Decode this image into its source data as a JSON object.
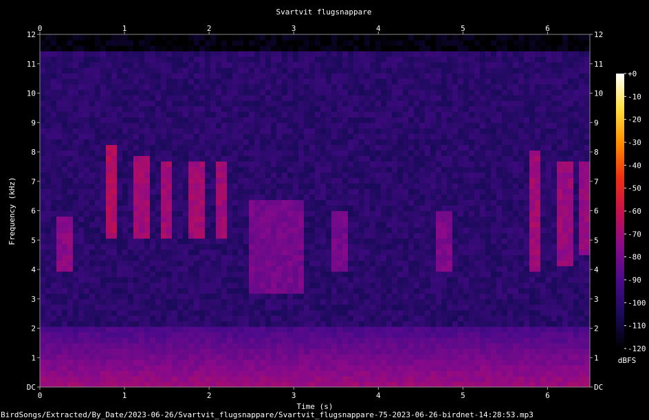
{
  "chart_data": {
    "type": "heatmap",
    "title": "Svartvit flugsnappare",
    "xlabel": "Time (s)",
    "ylabel": "Frequency (kHz)",
    "xlim": [
      0,
      6.5
    ],
    "ylim": [
      0,
      12
    ],
    "x_ticks": [
      "0",
      "1",
      "2",
      "3",
      "4",
      "5",
      "6"
    ],
    "y_ticks": [
      "DC",
      "1",
      "2",
      "3",
      "4",
      "5",
      "6",
      "7",
      "8",
      "9",
      "10",
      "11",
      "12"
    ],
    "colorbar": {
      "label": "dBFS",
      "ticks": [
        "+0",
        "-10",
        "-20",
        "-30",
        "-40",
        "-50",
        "-60",
        "-70",
        "-80",
        "-90",
        "-100",
        "-110",
        "-120"
      ],
      "range": [
        -120,
        0
      ],
      "colors": [
        "#000000",
        "#1a0a5a",
        "#4a0a8a",
        "#8a0a8a",
        "#c8104a",
        "#f03010",
        "#ff9000",
        "#ffe040",
        "#ffffff"
      ]
    },
    "background_level_db": -100,
    "calls": [
      {
        "t": 0.85,
        "f_low": 5.0,
        "f_high": 8.3,
        "level_db": -65
      },
      {
        "t": 1.2,
        "f_low": 5.1,
        "f_high": 7.9,
        "level_db": -70
      },
      {
        "t": 1.5,
        "f_low": 5.1,
        "f_high": 7.7,
        "level_db": -70
      },
      {
        "t": 1.85,
        "f_low": 5.1,
        "f_high": 7.7,
        "level_db": -70
      },
      {
        "t": 2.15,
        "f_low": 5.0,
        "f_high": 7.6,
        "level_db": -70
      },
      {
        "t": 0.3,
        "f_low": 4.0,
        "f_high": 5.9,
        "level_db": -75
      },
      {
        "t": 5.85,
        "f_low": 4.0,
        "f_high": 8.0,
        "level_db": -70
      },
      {
        "t": 6.2,
        "f_low": 4.2,
        "f_high": 7.7,
        "level_db": -72
      },
      {
        "t": 6.45,
        "f_low": 4.5,
        "f_high": 7.6,
        "level_db": -72
      },
      {
        "t": 4.8,
        "f_low": 4.0,
        "f_high": 6.0,
        "level_db": -78
      },
      {
        "t": 3.55,
        "f_low": 4.0,
        "f_high": 6.0,
        "level_db": -80
      }
    ],
    "noise_block": {
      "t_start": 2.45,
      "t_end": 3.1,
      "f_low": 3.2,
      "f_high": 6.3,
      "level_db": -80
    },
    "low_freq_noise": {
      "f_high": 2.0,
      "level_db": -70
    }
  },
  "caption": "BirdSongs/Extracted/By_Date/2023-06-26/Svartvit_flugsnappare/Svartvit_flugsnappare-75-2023-06-26-birdnet-14:28:53.mp3"
}
